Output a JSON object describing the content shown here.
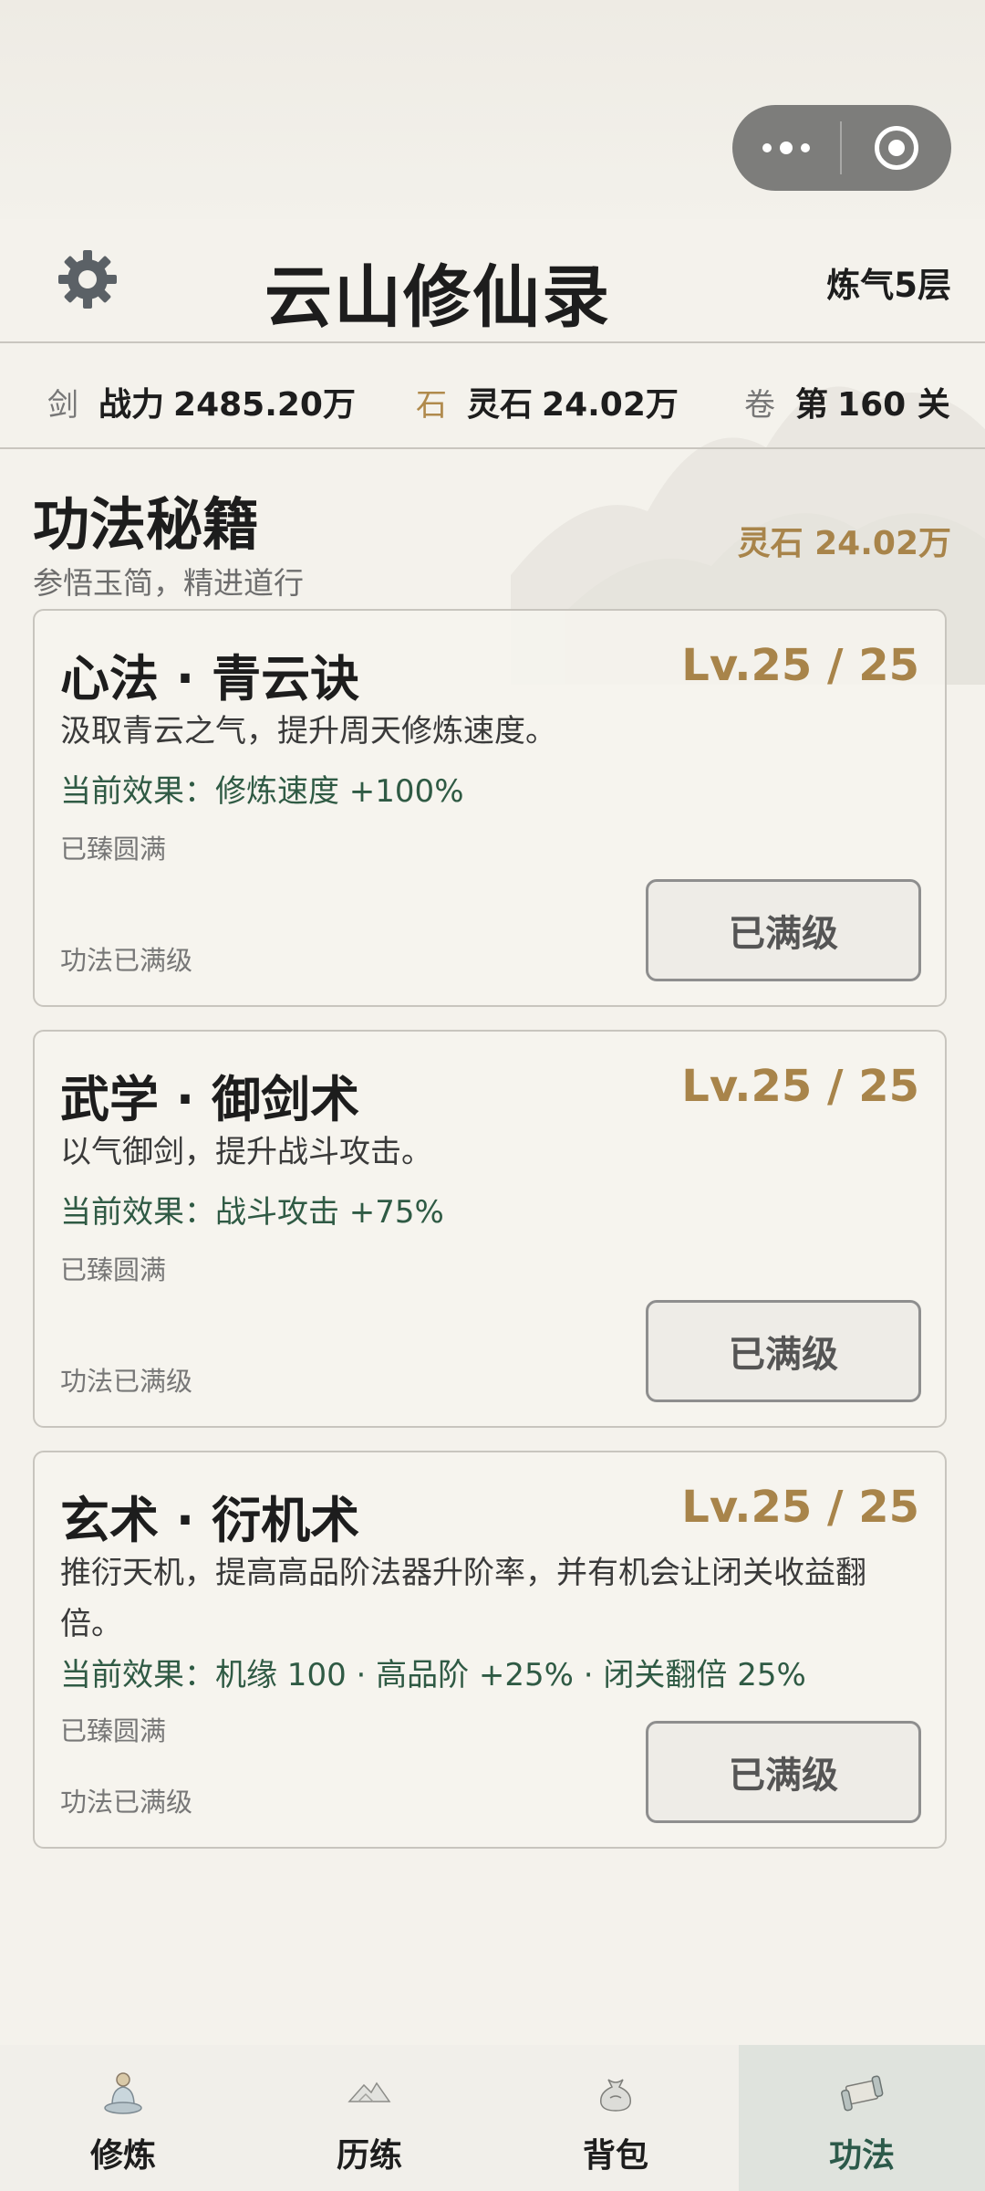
{
  "app": {
    "title": "云山修仙录",
    "realm": "炼气5层"
  },
  "stats": [
    {
      "icon": "剑",
      "label": "战力",
      "value": "2485.20万"
    },
    {
      "icon": "石",
      "label": "灵石",
      "value": "24.02万"
    },
    {
      "icon": "卷",
      "label": "第",
      "value": "160 关"
    }
  ],
  "section": {
    "title": "功法秘籍",
    "subtitle": "参悟玉简，精进道行",
    "stone_label": "灵石 24.02万"
  },
  "cards": [
    {
      "name": "心法 · 青云诀",
      "level": "Lv.25 / 25",
      "desc": "汲取青云之气，提升周天修炼速度。",
      "effect": "当前效果：修炼速度 +100%",
      "state": "已臻圆满",
      "foot": "功法已满级",
      "button": "已满级"
    },
    {
      "name": "武学 · 御剑术",
      "level": "Lv.25 / 25",
      "desc": "以气御剑，提升战斗攻击。",
      "effect": "当前效果：战斗攻击 +75%",
      "state": "已臻圆满",
      "foot": "功法已满级",
      "button": "已满级"
    },
    {
      "name": "玄术 · 衍机术",
      "level": "Lv.25 / 25",
      "desc": "推衍天机，提高高品阶法器升阶率，并有机会让闭关收益翻倍。",
      "effect": "当前效果：机缘 100 · 高品阶 +25% · 闭关翻倍 25%",
      "state": "已臻圆满",
      "foot": "功法已满级",
      "button": "已满级"
    }
  ],
  "tabs": [
    {
      "label": "修炼",
      "icon": "meditating-cultivator-icon",
      "active": false
    },
    {
      "label": "历练",
      "icon": "mountain-icon",
      "active": false
    },
    {
      "label": "背包",
      "icon": "pouch-icon",
      "active": false
    },
    {
      "label": "功法",
      "icon": "scroll-icon",
      "active": true
    }
  ],
  "colors": {
    "gold": "#a8844a",
    "jade": "#2f5a44",
    "active_tab": "#dfe3dd"
  }
}
